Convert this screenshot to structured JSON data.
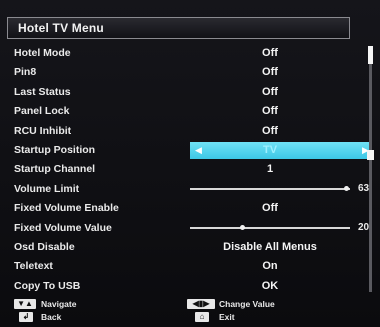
{
  "title": "Hotel TV Menu",
  "rows": [
    {
      "label": "Hotel Mode",
      "value": "Off"
    },
    {
      "label": "Pin8",
      "value": "Off"
    },
    {
      "label": "Last Status",
      "value": "Off"
    },
    {
      "label": "Panel Lock",
      "value": "Off"
    },
    {
      "label": "RCU Inhibit",
      "value": "Off"
    },
    {
      "label": "Startup Position",
      "value": "TV"
    },
    {
      "label": "Startup Channel",
      "value": "1"
    },
    {
      "label": "Volume Limit",
      "value": "63",
      "slider_fraction": 0.98
    },
    {
      "label": "Fixed Volume Enable",
      "value": "Off"
    },
    {
      "label": "Fixed Volume Value",
      "value": "20",
      "slider_fraction": 0.33
    },
    {
      "label": "Osd Disable",
      "value": "Disable All Menus"
    },
    {
      "label": "Teletext",
      "value": "On"
    },
    {
      "label": "Copy To USB",
      "value": "OK"
    }
  ],
  "selected_row": "Startup Position",
  "footer": {
    "navigate": "Navigate",
    "back": "Back",
    "change_value": "Change Value",
    "exit": "Exit"
  }
}
